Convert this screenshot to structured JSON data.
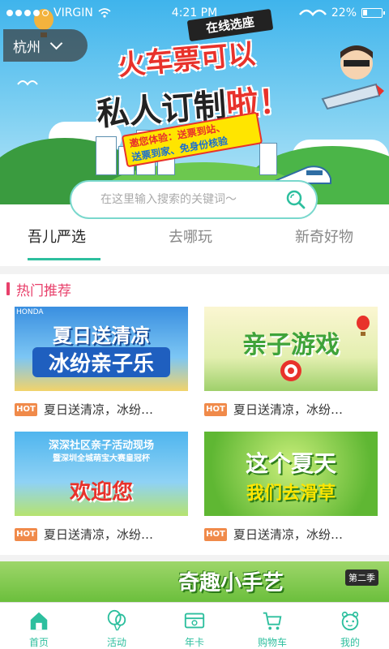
{
  "status_bar": {
    "carrier": "VIRGIN",
    "time": "4:21 PM",
    "battery": "22%"
  },
  "city_selector": {
    "city": "杭州"
  },
  "banner": {
    "tag": "在线选座",
    "headline_line1": "火车票可以",
    "headline_line2_part1": "私人订制",
    "headline_line2_part2": "啦！",
    "promo_line1": "邀您体验：送票到站、",
    "promo_line2": "送票到家、免身份核验"
  },
  "search": {
    "placeholder": "在这里输入搜索的关键词～"
  },
  "tabs": [
    {
      "label": "吾儿严选",
      "active": true
    },
    {
      "label": "去哪玩",
      "active": false
    },
    {
      "label": "新奇好物",
      "active": false
    }
  ],
  "hot_section": {
    "title": "热门推荐",
    "badge": "HOT",
    "cards": [
      {
        "image_title_line1": "夏日送清凉",
        "image_title_line2": "冰纷亲子乐",
        "image_corner": "HONDA",
        "caption": "夏日送清凉，冰纷…"
      },
      {
        "image_title_line1": "亲子游戏",
        "image_title_line2": "",
        "image_corner": "",
        "caption": "夏日送清凉，冰纷…"
      },
      {
        "image_title_line1": "深深社区亲子活动现场",
        "image_title_line2": "欢迎您",
        "image_subtitle": "暨深圳全城萌宝大赛皇冠杯",
        "image_corner": "",
        "caption": "夏日送清凉，冰纷…"
      },
      {
        "image_title_line1": "这个夏天",
        "image_title_line2": "我们去滑草",
        "image_corner": "",
        "caption": "夏日送清凉，冰纷…"
      }
    ]
  },
  "bottom_banner": {
    "title": "奇趣小手艺",
    "tag": "第二季"
  },
  "bottom_nav": [
    {
      "label": "首页",
      "icon": "home-icon"
    },
    {
      "label": "活动",
      "icon": "balloon-icon"
    },
    {
      "label": "年卡",
      "icon": "card-icon"
    },
    {
      "label": "购物车",
      "icon": "cart-icon"
    },
    {
      "label": "我的",
      "icon": "profile-icon"
    }
  ],
  "colors": {
    "accent": "#2dbf9e",
    "hot_title": "#e8406b",
    "hot_badge": "#f08a4a",
    "banner_red": "#e8322b"
  }
}
